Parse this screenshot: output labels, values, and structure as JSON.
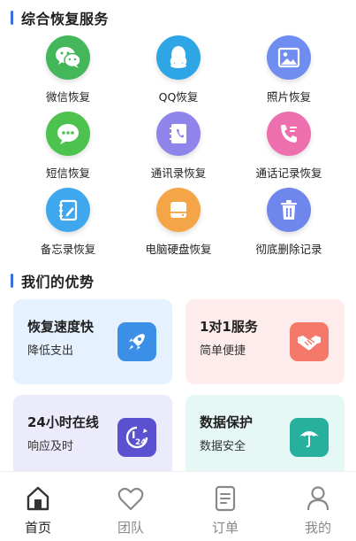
{
  "section_services": {
    "title": "综合恢复服务"
  },
  "services": [
    {
      "label": "微信恢复",
      "icon": "wechat-icon",
      "color": "#43b75a"
    },
    {
      "label": "QQ恢复",
      "icon": "qq-icon",
      "color": "#2ea6e6"
    },
    {
      "label": "照片恢复",
      "icon": "photo-icon",
      "color": "#6f8df0"
    },
    {
      "label": "短信恢复",
      "icon": "sms-icon",
      "color": "#4ec24e"
    },
    {
      "label": "通讯录恢复",
      "icon": "contacts-icon",
      "color": "#8e84ea"
    },
    {
      "label": "通话记录恢复",
      "icon": "phone-icon",
      "color": "#ee6fae"
    },
    {
      "label": "备忘录恢复",
      "icon": "memo-icon",
      "color": "#3fa7ee"
    },
    {
      "label": "电脑硬盘恢复",
      "icon": "harddisk-icon",
      "color": "#f3a548"
    },
    {
      "label": "彻底删除记录",
      "icon": "trash-icon",
      "color": "#6f86ec"
    }
  ],
  "section_advantages": {
    "title": "我们的优势"
  },
  "advantages": [
    {
      "title": "恢复速度快",
      "subtitle": "降低支出",
      "icon": "rocket-icon",
      "bg": "#e5f1fe",
      "icon_color": "#3c8fe6"
    },
    {
      "title": "1对1服务",
      "subtitle": "简单便捷",
      "icon": "handshake-icon",
      "bg": "#fdeceb",
      "icon_color": "#f5796a"
    },
    {
      "title": "24小时在线",
      "subtitle": "响应及时",
      "icon": "clock-24-icon",
      "bg": "#ecebfc",
      "icon_color": "#5b50cf"
    },
    {
      "title": "数据保护",
      "subtitle": "数据安全",
      "icon": "umbrella-icon",
      "bg": "#e6f8f6",
      "icon_color": "#26b09d"
    }
  ],
  "tabbar": {
    "items": [
      {
        "label": "首页",
        "icon": "home-icon",
        "active": true
      },
      {
        "label": "团队",
        "icon": "heart-icon",
        "active": false
      },
      {
        "label": "订单",
        "icon": "order-icon",
        "active": false
      },
      {
        "label": "我的",
        "icon": "user-icon",
        "active": false
      }
    ]
  }
}
